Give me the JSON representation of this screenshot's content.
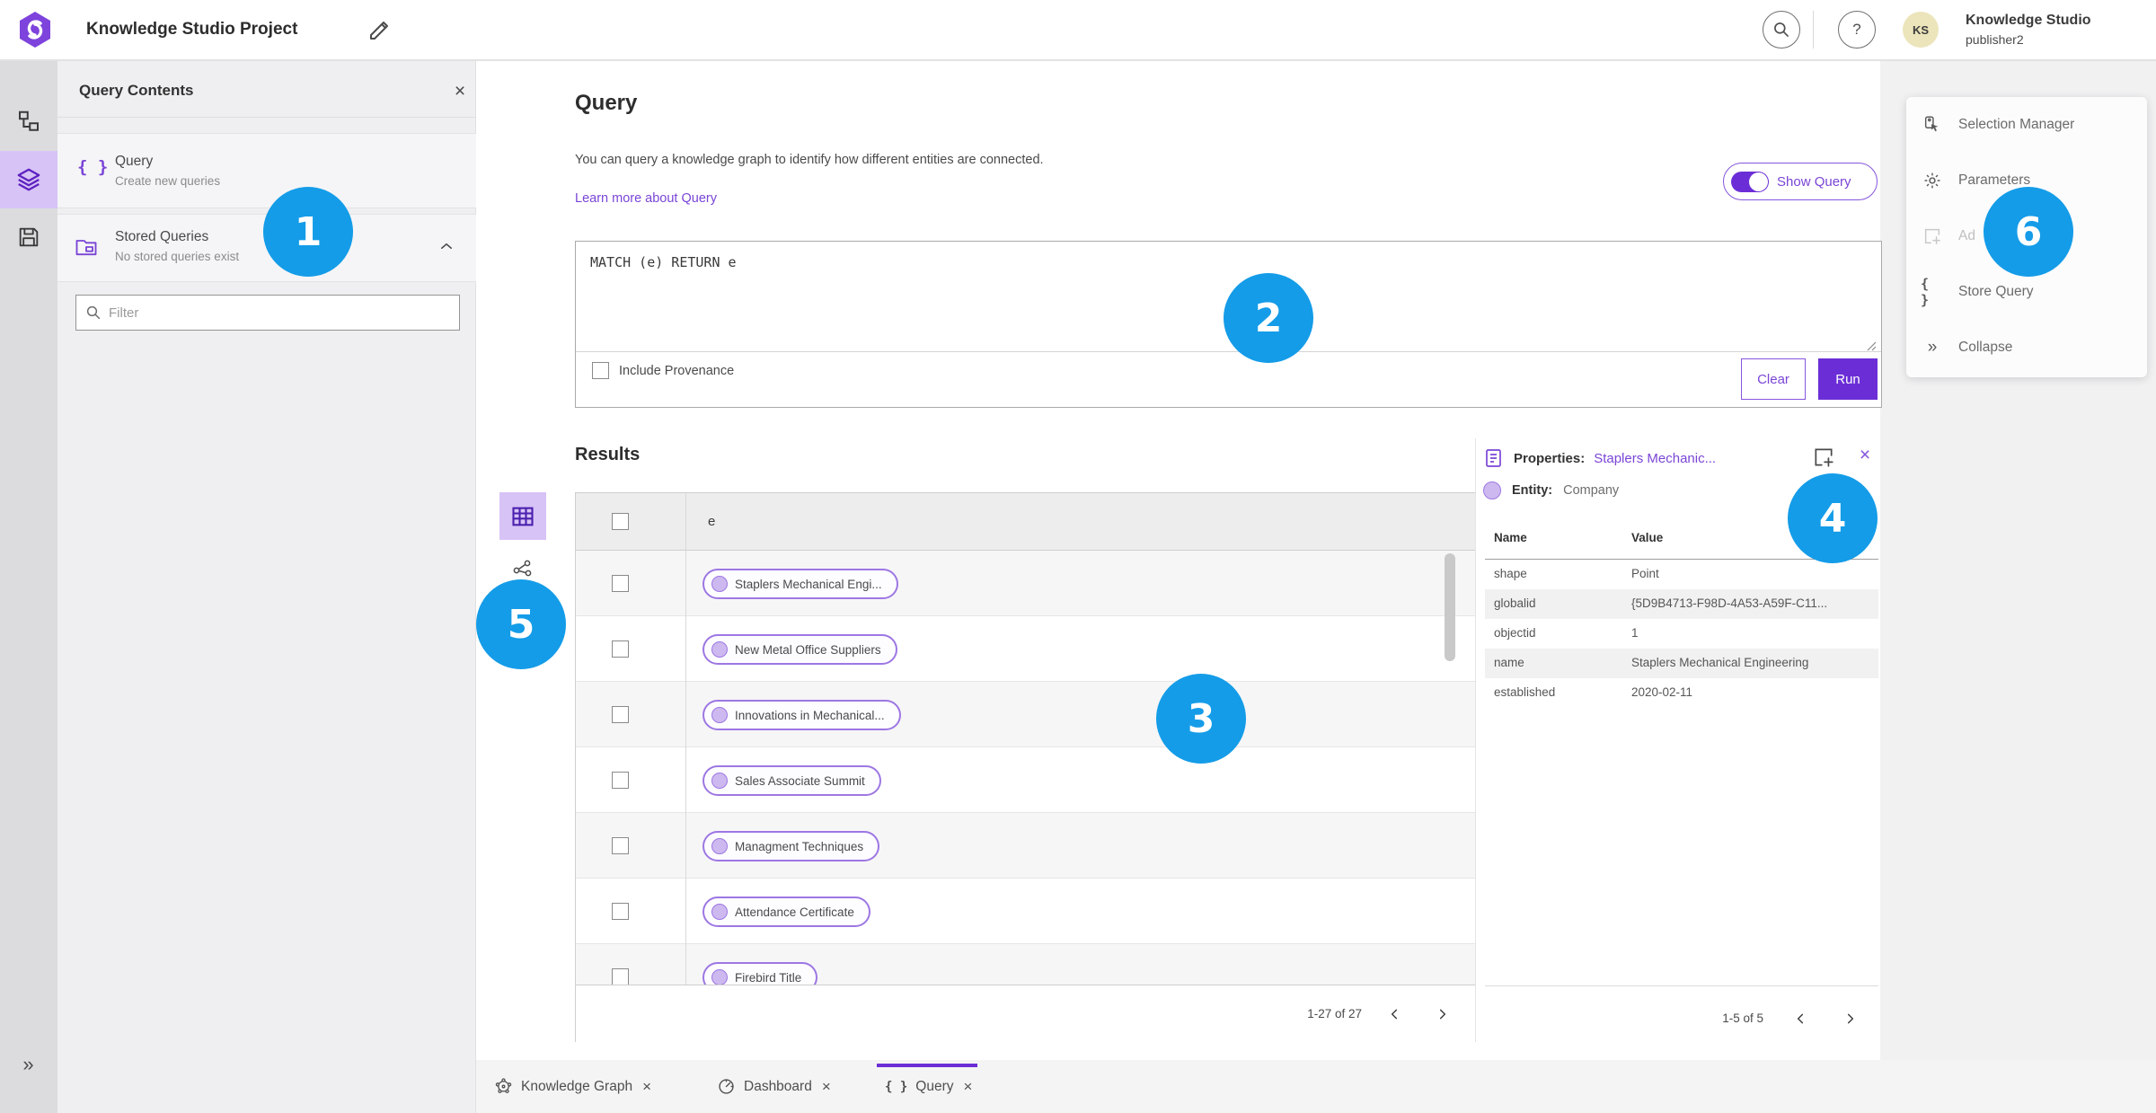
{
  "topbar": {
    "title": "Knowledge Studio Project",
    "user_name": "Knowledge Studio",
    "user_role": "publisher2",
    "avatar_initials": "KS",
    "help_glyph": "?"
  },
  "icons": {
    "braces": "{ }",
    "close": "×",
    "double_chevron": "»"
  },
  "query_contents": {
    "title": "Query Contents",
    "query_item": {
      "title": "Query",
      "subtitle": "Create new queries"
    },
    "stored_item": {
      "title": "Stored Queries",
      "subtitle": "No stored queries exist"
    },
    "filter_placeholder": "Filter"
  },
  "query_panel": {
    "heading": "Query",
    "description": "You can query a knowledge graph to identify how different entities are connected.",
    "learn_more": "Learn more about Query",
    "show_query_label": "Show Query",
    "query_text": "MATCH (e) RETURN e",
    "include_provenance_label": "Include Provenance",
    "clear_label": "Clear",
    "run_label": "Run"
  },
  "results": {
    "heading": "Results",
    "column_header": "e",
    "rows": [
      {
        "label": "Staplers Mechanical Engi..."
      },
      {
        "label": "New Metal Office Suppliers"
      },
      {
        "label": "Innovations in Mechanical..."
      },
      {
        "label": "Sales Associate Summit"
      },
      {
        "label": "Managment Techniques"
      },
      {
        "label": "Attendance Certificate"
      },
      {
        "label": "Firebird Title"
      }
    ],
    "pagination": "1-27 of 27"
  },
  "properties": {
    "title_prefix": "Properties:",
    "title_link": "Staplers Mechanic...",
    "entity_prefix": "Entity:",
    "entity_value": "Company",
    "name_header": "Name",
    "value_header": "Value",
    "rows": [
      {
        "name": "shape",
        "value": "Point"
      },
      {
        "name": "globalid",
        "value": "{5D9B4713-F98D-4A53-A59F-C11..."
      },
      {
        "name": "objectid",
        "value": "1"
      },
      {
        "name": "name",
        "value": "Staplers Mechanical Engineering"
      },
      {
        "name": "established",
        "value": "2020-02-11"
      }
    ],
    "pagination": "1-5 of 5"
  },
  "tools_menu": {
    "items": [
      {
        "label": "Selection Manager"
      },
      {
        "label": "Parameters"
      },
      {
        "label": "Ad"
      },
      {
        "label": "Store Query"
      },
      {
        "label": "Collapse"
      }
    ]
  },
  "tabbar": {
    "tabs": [
      {
        "label": "Knowledge Graph"
      },
      {
        "label": "Dashboard"
      },
      {
        "label": "Query"
      }
    ]
  },
  "annotations": [
    {
      "number": "1"
    },
    {
      "number": "2"
    },
    {
      "number": "3"
    },
    {
      "number": "4"
    },
    {
      "number": "5"
    },
    {
      "number": "6"
    }
  ],
  "colors": {
    "accent_purple": "#6b2ed6",
    "link_purple": "#7a45d6",
    "chip_border_purple": "#9d77e3",
    "annotation_blue": "#149ce8"
  }
}
